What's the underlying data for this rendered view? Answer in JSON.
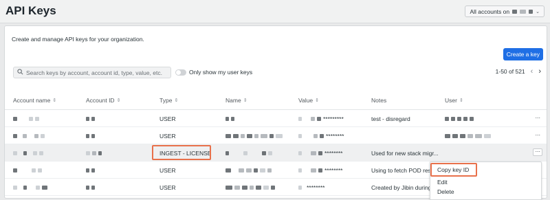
{
  "header": {
    "title": "API Keys",
    "account_selector_label": "All accounts on"
  },
  "description": "Create and manage API keys for your organization.",
  "create_button": "Create a key",
  "search": {
    "placeholder": "Search keys by account, account id, type, value, etc."
  },
  "toggle_label": "Only show my user keys",
  "pagination": {
    "range": "1-50 of 521"
  },
  "columns": [
    "Account name",
    "Account ID",
    "Type",
    "Name",
    "Value",
    "Notes",
    "User"
  ],
  "rows": [
    {
      "type": "USER",
      "value_suffix": "*********",
      "notes": "test - disregard"
    },
    {
      "type": "USER",
      "value_suffix": "********",
      "notes": ""
    },
    {
      "type": "INGEST - LICENSE",
      "value_suffix": "********",
      "notes": "Used for new stack migr..."
    },
    {
      "type": "USER",
      "value_suffix": "********",
      "notes": "Using to fetch POD resa"
    },
    {
      "type": "USER",
      "value_suffix": "********",
      "notes": "Created by Jibin during"
    }
  ],
  "context_menu": {
    "copy": "Copy key ID",
    "edit": "Edit",
    "delete": "Delete"
  },
  "colors": {
    "accent": "#1f6fe5",
    "annotation": "#e8704a"
  }
}
